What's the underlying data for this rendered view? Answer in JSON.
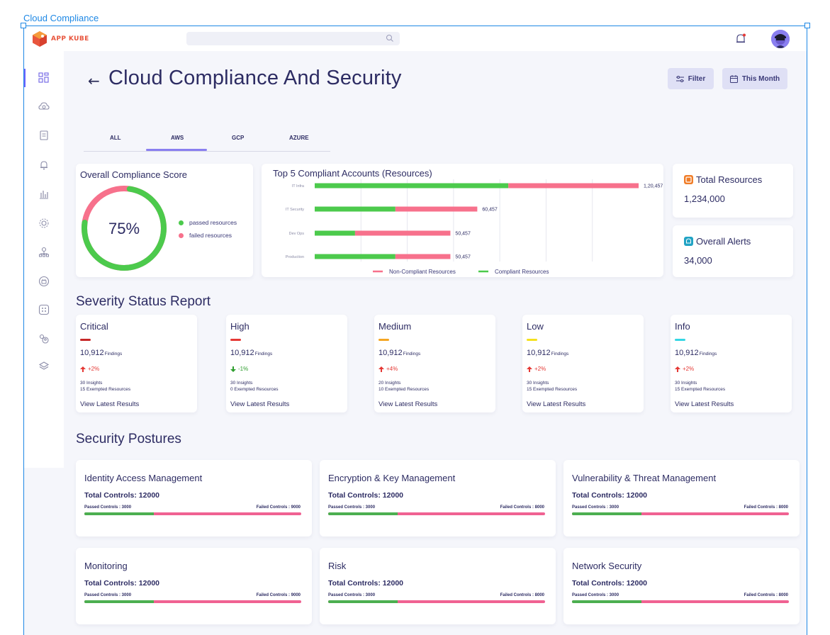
{
  "frame_label": "Cloud Compliance",
  "app": {
    "logo_text": "APP KUBE"
  },
  "header": {
    "search_icon": "search-icon",
    "bell_icon": "bell-icon",
    "notification_color": "#e53935"
  },
  "sidebar": {
    "items": [
      {
        "icon": "dashboard-icon",
        "active": true
      },
      {
        "icon": "cloud-recycle-icon"
      },
      {
        "icon": "clipboard-icon"
      },
      {
        "icon": "alert-bell-icon"
      },
      {
        "icon": "bar-chart-icon"
      },
      {
        "icon": "settings-cog-icon"
      },
      {
        "icon": "tree-network-icon"
      },
      {
        "icon": "briefcase-icon"
      },
      {
        "icon": "grid-box-icon"
      },
      {
        "icon": "users-settings-icon"
      },
      {
        "icon": "layers-icon"
      }
    ]
  },
  "page": {
    "title": "Cloud Compliance And Security",
    "filter_label": "Filter",
    "period_label": "This Month"
  },
  "tabs": [
    {
      "label": "ALL"
    },
    {
      "label": "AWS",
      "active": true
    },
    {
      "label": "GCP"
    },
    {
      "label": "AZURE"
    }
  ],
  "compliance_score": {
    "title": "Overall Compliance Score",
    "value_text": "75%",
    "passed_fraction": 0.75,
    "legend": [
      {
        "label": "passed resources",
        "color": "#4cca4c"
      },
      {
        "label": "failed resources",
        "color": "#f7718c"
      }
    ]
  },
  "chart_data": {
    "type": "bar",
    "orientation": "horizontal",
    "stacked": true,
    "title": "Top 5 Compliant Accounts (Resources)",
    "categories": [
      "IT Infra",
      "IT Security",
      "Dev Ops",
      "Production"
    ],
    "totals": [
      "1,20,457",
      "60,457",
      "50,457",
      "50,457"
    ],
    "series": [
      {
        "name": "Compliant Resources",
        "color": "#4cca4c",
        "values": [
          72000,
          30000,
          15000,
          30000
        ]
      },
      {
        "name": "Non-Compliant Resources",
        "color": "#f7718c",
        "values": [
          48457,
          30457,
          35457,
          20457
        ]
      }
    ],
    "legend_order": [
      "Non-Compliant Resources",
      "Compliant Resources"
    ],
    "grid": true,
    "legend_position": "bottom"
  },
  "summary": {
    "total_resources": {
      "label": "Total Resources",
      "value": "1,234,000",
      "color": "#f07d28"
    },
    "overall_alerts": {
      "label": "Overall Alerts",
      "value": "34,000",
      "color": "#21a3c4"
    }
  },
  "severity": {
    "title": "Severity Status Report",
    "findings_label": "Findings",
    "link_label": "View Latest Results",
    "items": [
      {
        "name": "Critical",
        "color": "#c62828",
        "count": "10,912",
        "trend": "+2%",
        "direction": "up",
        "insights": "30 Insights",
        "exempted": "15 Exempted Resources"
      },
      {
        "name": "High",
        "color": "#e53935",
        "count": "10,912",
        "trend": "-1%",
        "direction": "down",
        "insights": "30 Insights",
        "exempted": "0 Exempted Resources"
      },
      {
        "name": "Medium",
        "color": "#f5a623",
        "count": "10,912",
        "trend": "+4%",
        "direction": "up",
        "insights": "20 Insights",
        "exempted": "10 Exempted Resources"
      },
      {
        "name": "Low",
        "color": "#f5e11e",
        "count": "10,912",
        "trend": "+2%",
        "direction": "up",
        "insights": "30 Insights",
        "exempted": "15 Exempted Resources"
      },
      {
        "name": "Info",
        "color": "#35d6e4",
        "count": "10,912",
        "trend": "+2%",
        "direction": "up",
        "insights": "30 Insights",
        "exempted": "15 Exempted Resources"
      }
    ]
  },
  "postures": {
    "title": "Security Postures",
    "items": [
      {
        "name": "Identity Access Management",
        "total": "Total Controls:  12000",
        "passed": "Passed Controls : 3000",
        "failed": "Failed Controls : 9000",
        "passed_fraction": 0.32
      },
      {
        "name": "Encryption & Key Management",
        "total": "Total Controls:  12000",
        "passed": "Passed Controls : 3000",
        "failed": "Failed Controls : 8000",
        "passed_fraction": 0.32
      },
      {
        "name": "Vulnerability & Threat Management",
        "total": "Total Controls:  12000",
        "passed": "Passed Controls : 3000",
        "failed": "Failed Controls : 8000",
        "passed_fraction": 0.32
      },
      {
        "name": "Monitoring",
        "total": "Total Controls:  12000",
        "passed": "Passed Controls : 3000",
        "failed": "Failed Controls : 9000",
        "passed_fraction": 0.32
      },
      {
        "name": "Risk",
        "total": "Total Controls:  12000",
        "passed": "Passed Controls : 3000",
        "failed": "Failed Controls : 8000",
        "passed_fraction": 0.32
      },
      {
        "name": "Network Security",
        "total": "Total Controls:  12000",
        "passed": "Passed Controls : 3000",
        "failed": "Failed Controls : 8000",
        "passed_fraction": 0.32
      }
    ]
  }
}
